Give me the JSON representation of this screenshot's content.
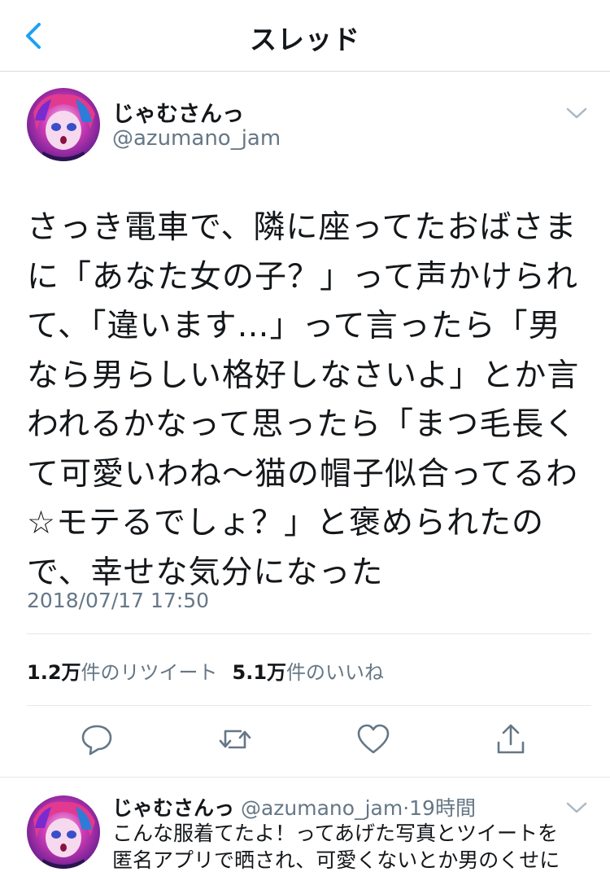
{
  "navbar": {
    "title": "スレッド",
    "back_icon": "chevron-left-icon"
  },
  "tweet": {
    "display_name": "じゃむさんっ",
    "handle": "@azumano_jam",
    "text": "さっき電車で、隣に座ってたおばさま\nに「あなた女の子？」って声かけられ\nて、「違います…」って言ったら「男\nなら男らしい格好しなさいよ」とか言\nわれるかなって思ったら「まつ毛長く\nて可愛いわね〜猫の帽子似合ってるわ\n☆モテるでしょ？」と褒められたの\nで、幸せな気分になった",
    "timestamp": "2018/07/17 17:50",
    "retweet_count": "1.2万",
    "retweet_label": "件のリツイート",
    "like_count": "5.1万",
    "like_label": "件のいいね"
  },
  "actions": {
    "reply_icon": "reply-icon",
    "retweet_icon": "retweet-icon",
    "like_icon": "heart-icon",
    "share_icon": "share-icon"
  },
  "reply_tweet": {
    "display_name": "じゃむさんっ",
    "handle": "@azumano_jam",
    "separator": "·",
    "time": "19時間",
    "text": "こんな服着てたよ！ってあげた写真とツイートを\n匿名アプリで晒され、可愛くないとか男のくせに"
  },
  "colors": {
    "accent": "#1da1f2",
    "text_primary": "#14171a",
    "text_secondary": "#657786",
    "divider": "#e1e8ed"
  }
}
